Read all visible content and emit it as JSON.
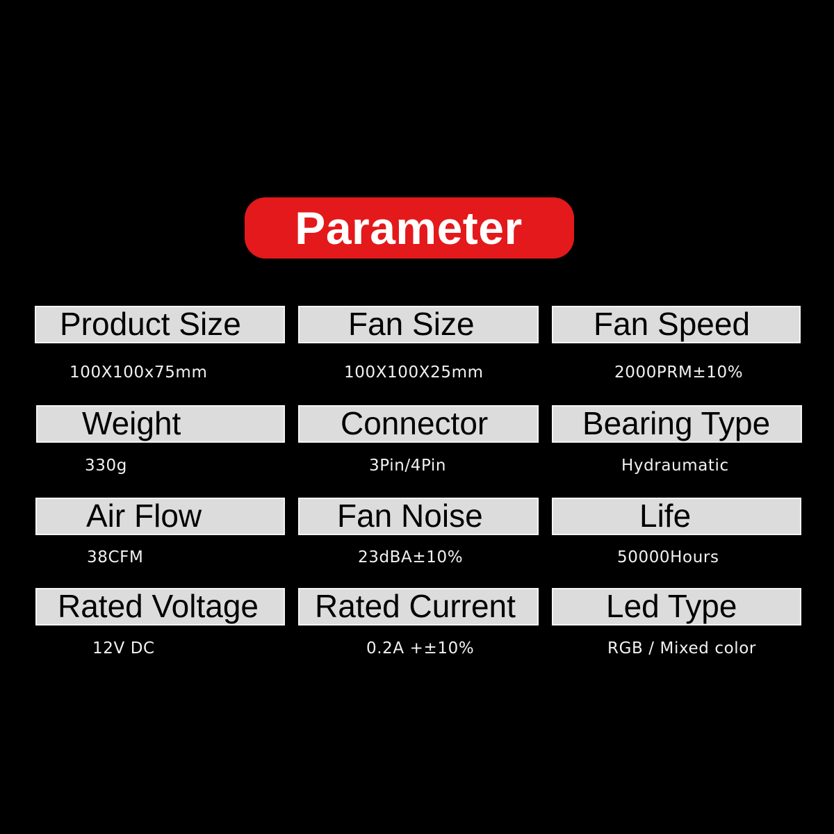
{
  "title": "Parameter",
  "colors": {
    "background": "#000000",
    "accent": "#e3191b",
    "label_box": "#dcdcdc",
    "label_text": "#000000",
    "value_text": "#f2f2f2"
  },
  "parameters": [
    {
      "label": "Product Size",
      "value": "100X100x75mm"
    },
    {
      "label": "Fan Size",
      "value": "100X100X25mm"
    },
    {
      "label": "Fan Speed",
      "value": "2000PRM±10%"
    },
    {
      "label": "Weight",
      "value": "330g"
    },
    {
      "label": "Connector",
      "value": "3Pin/4Pin"
    },
    {
      "label": "Bearing Type",
      "value": "Hydraumatic"
    },
    {
      "label": "Air Flow",
      "value": "38CFM"
    },
    {
      "label": "Fan Noise",
      "value": "23dBA±10%"
    },
    {
      "label": "Life",
      "value": "50000Hours"
    },
    {
      "label": "Rated Voltage",
      "value": "12V DC"
    },
    {
      "label": "Rated Current",
      "value": "0.2A +±10%"
    },
    {
      "label": "Led Type",
      "value": "RGB / Mixed color"
    }
  ]
}
